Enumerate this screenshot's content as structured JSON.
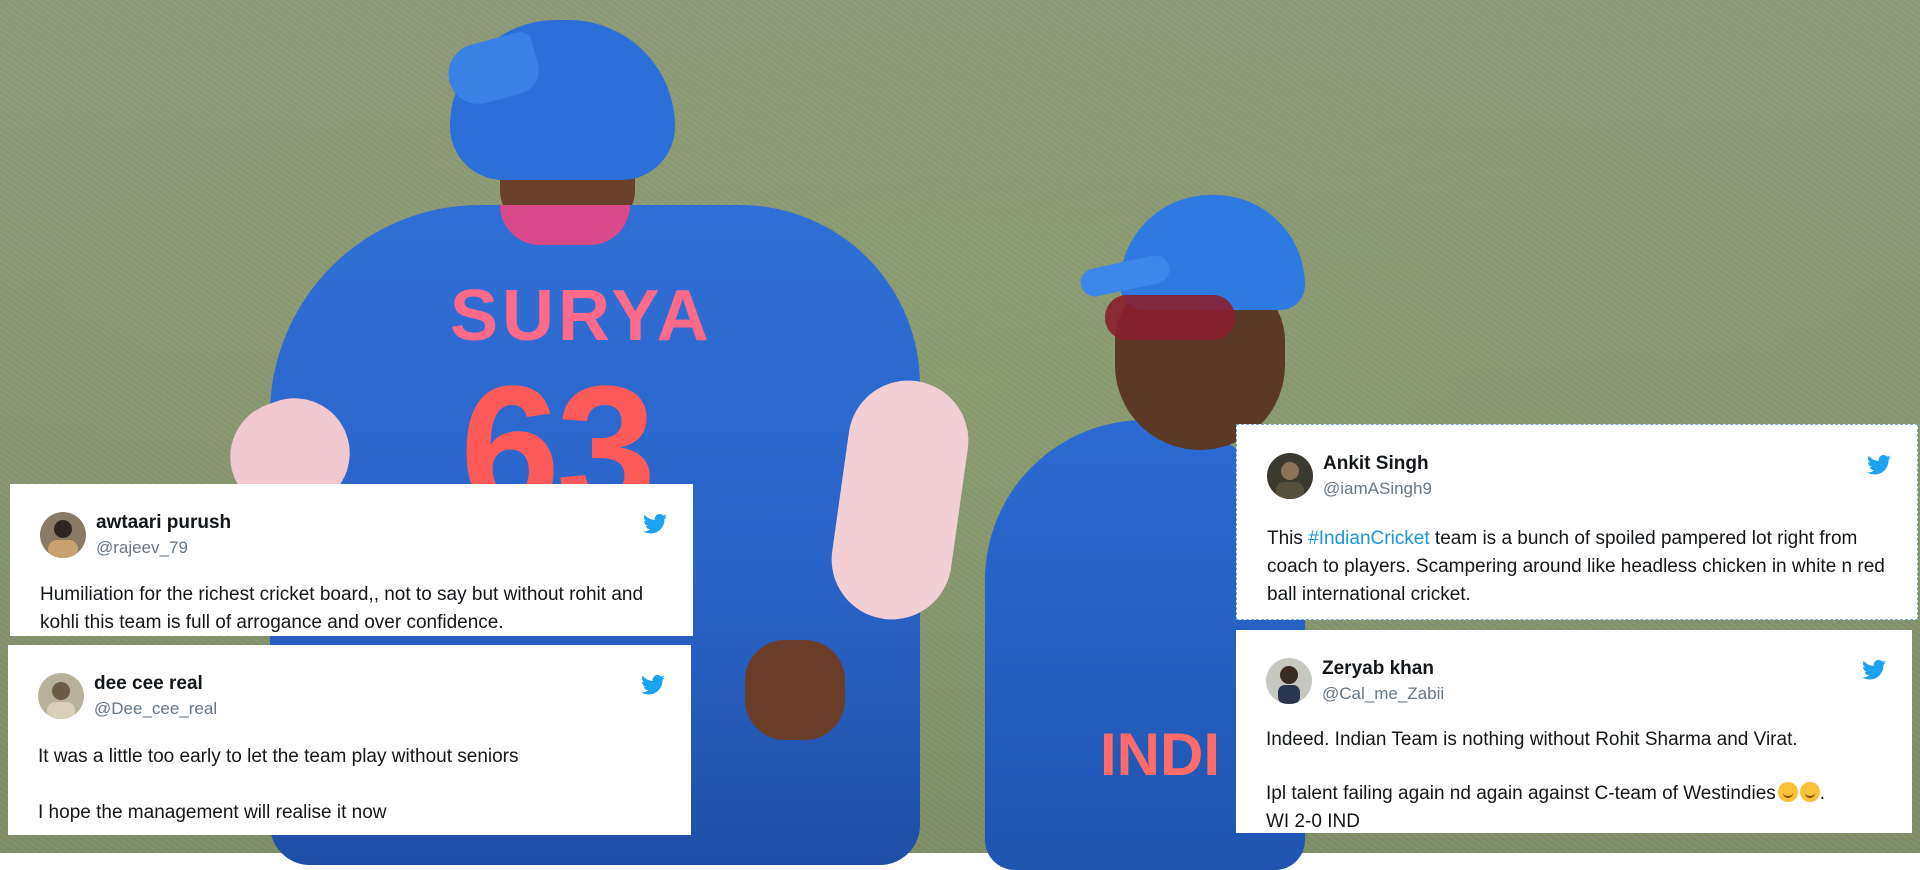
{
  "background": {
    "jersey_name": "SURYA",
    "jersey_number": "63",
    "second_jersey_text": "INDI"
  },
  "colors": {
    "twitter_blue": "#1da1f2",
    "hashtag_blue": "#1b95e0",
    "handle_gray": "#657786"
  },
  "tweets": [
    {
      "name": "awtaari purush",
      "handle": "@rajeev_79",
      "avatar_icon": "user-avatar",
      "paragraphs": [
        "Humiliation for the richest cricket board,, not to say but without rohit and kohli this team is full of arrogance and over confidence."
      ]
    },
    {
      "name": "dee cee real",
      "handle": "@Dee_cee_real",
      "avatar_icon": "user-avatar",
      "paragraphs": [
        "It was a little too early to let the team play without seniors",
        "I hope the management will realise it now"
      ]
    },
    {
      "name": "Ankit Singh",
      "handle": "@iamASingh9",
      "avatar_icon": "user-avatar",
      "text_before": "This ",
      "hashtag": "#IndianCricket",
      "text_after": " team is a bunch of spoiled pampered lot right from coach to players.  Scampering around like headless chicken in white n red ball international cricket."
    },
    {
      "name": "Zeryab khan",
      "handle": "@Cal_me_Zabii",
      "avatar_icon": "user-avatar",
      "p1": "Indeed. Indian Team is nothing without Rohit Sharma and Virat.",
      "p2": "Ipl talent failing again nd again against C-team of Westindies",
      "p2_emojis": "smiling-face-emoji x2",
      "p3": "WI 2-0 IND"
    }
  ]
}
